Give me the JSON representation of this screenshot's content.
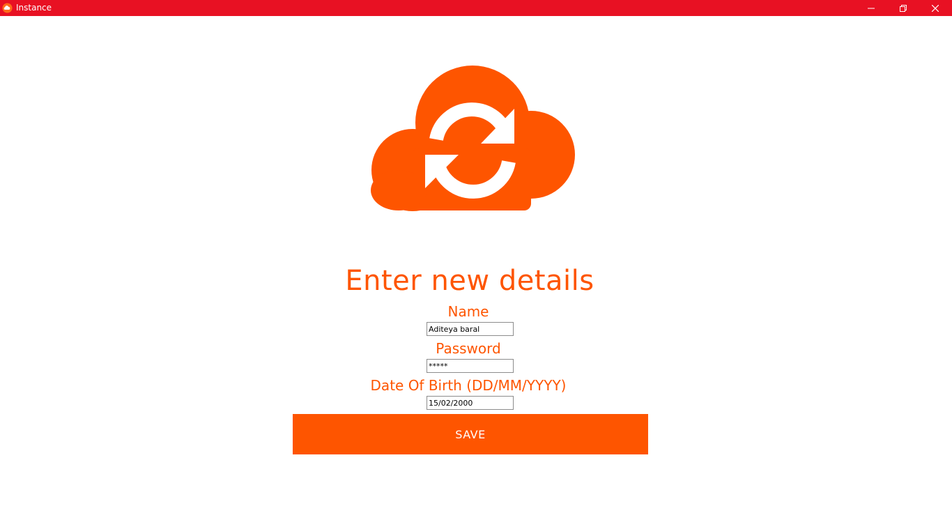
{
  "window": {
    "title": "Instance",
    "titlebar_color": "#e81123",
    "app_icon": "cloud-sync-icon",
    "controls": {
      "minimize_icon": "minimize-icon",
      "maximize_icon": "restore-icon",
      "close_icon": "close-icon"
    }
  },
  "logo": {
    "icon": "cloud-sync-icon",
    "color": "#fe5500"
  },
  "form": {
    "heading": "Enter new details",
    "name_label": "Name",
    "name_value": "Aditeya baral",
    "password_label": "Password",
    "password_value": "*****",
    "dob_label": "Date Of Birth (DD/MM/YYYY)",
    "dob_value": "15/02/2000",
    "save_label": "SAVE"
  },
  "colors": {
    "accent": "#fe5500",
    "background": "#ffffff"
  }
}
